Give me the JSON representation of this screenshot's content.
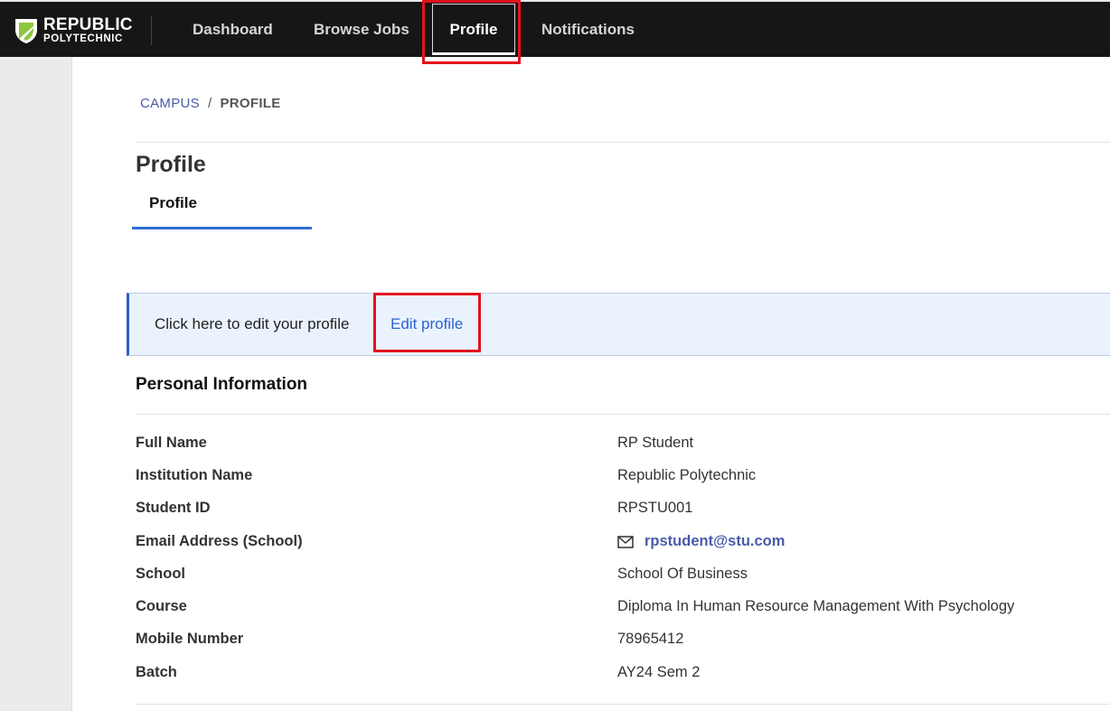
{
  "brand": {
    "line1": "REPUBLIC",
    "line2": "POLYTECHNIC",
    "accent": "#8dc63f"
  },
  "nav": {
    "dashboard": "Dashboard",
    "browse_jobs": "Browse Jobs",
    "profile": "Profile",
    "notifications": "Notifications"
  },
  "breadcrumb": {
    "campus": "CAMPUS",
    "separator": "/",
    "current": "PROFILE"
  },
  "page": {
    "title": "Profile",
    "tab": "Profile"
  },
  "banner": {
    "text": "Click here to edit your profile",
    "link": "Edit profile"
  },
  "personal": {
    "title": "Personal Information",
    "labels": {
      "full_name": "Full Name",
      "institution": "Institution Name",
      "student_id": "Student ID",
      "email": "Email Address (School)",
      "school": "School",
      "course": "Course",
      "mobile": "Mobile Number",
      "batch": "Batch"
    },
    "values": {
      "full_name": "RP Student",
      "institution": "Republic Polytechnic",
      "student_id": "RPSTU001",
      "email": "rpstudent@stu.com",
      "school": "School Of Business",
      "course": "Diploma In Human Resource Management With Psychology",
      "mobile": "78965412",
      "batch": "AY24 Sem 2"
    }
  },
  "icons": {
    "logo": "shield-logo-icon",
    "email": "mail-icon"
  },
  "colors": {
    "topbar": "#161616",
    "highlight": "#e3121e",
    "link": "#2b62d6",
    "tab_underline": "#2f6fd6",
    "banner_bg": "#eaf3fd"
  }
}
